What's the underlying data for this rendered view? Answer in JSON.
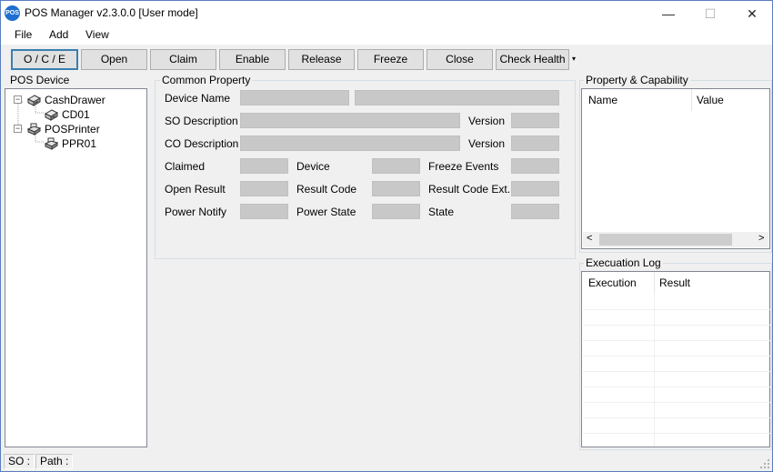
{
  "window": {
    "icon_text": "POS",
    "title": "POS Manager v2.3.0.0  [User mode]",
    "minimize": "—",
    "maximize": "☐",
    "close": "✕"
  },
  "menu": [
    "File",
    "Add",
    "View"
  ],
  "toolbar": {
    "buttons": [
      "O / C / E",
      "Open",
      "Claim",
      "Enable",
      "Release",
      "Freeze",
      "Close",
      "Check Health"
    ],
    "dropdown_glyph": "▾"
  },
  "pos_device": {
    "label": "POS Device",
    "tree": [
      {
        "label": "CashDrawer",
        "expander": "−",
        "children": [
          {
            "label": "CD01"
          }
        ]
      },
      {
        "label": "POSPrinter",
        "expander": "−",
        "children": [
          {
            "label": "PPR01"
          }
        ]
      }
    ]
  },
  "common_property": {
    "label": "Common Property",
    "device_name": "Device Name",
    "so_description": "SO Description",
    "co_description": "CO Description",
    "version": "Version",
    "claimed": "Claimed",
    "device": "Device",
    "freeze_events": "Freeze Events",
    "open_result": "Open Result",
    "result_code": "Result Code",
    "result_code_ext": "Result Code Ext.",
    "power_notify": "Power Notify",
    "power_state": "Power State",
    "state": "State"
  },
  "property_capability": {
    "label": "Property & Capability",
    "columns": [
      "Name",
      "Value"
    ],
    "scroll_left": "<",
    "scroll_right": ">"
  },
  "execution_log": {
    "label": "Execuation Log",
    "columns": [
      "Execution",
      "Result"
    ]
  },
  "status": {
    "so": "SO :",
    "path": "Path :"
  }
}
